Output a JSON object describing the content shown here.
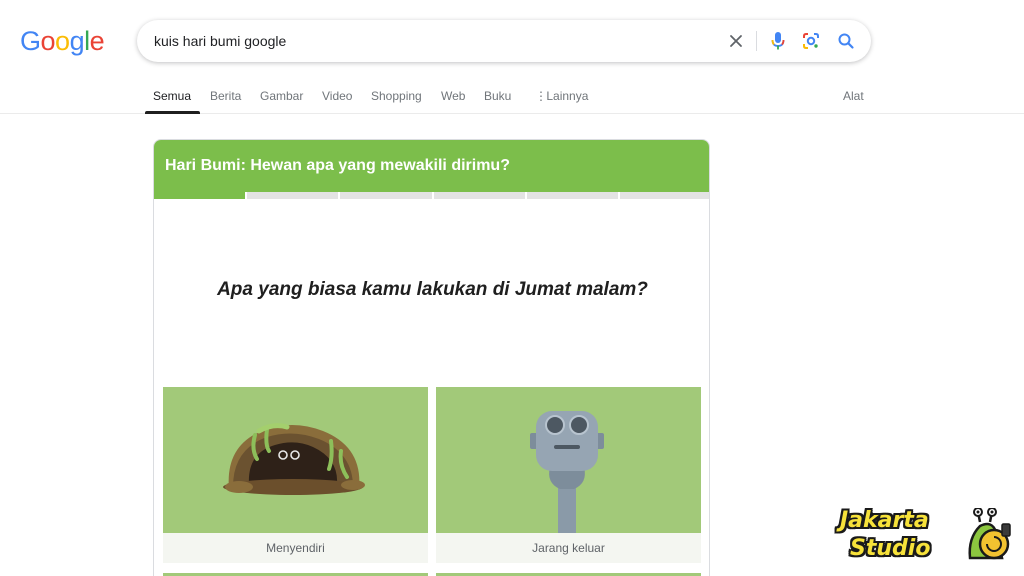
{
  "logo": {
    "letters": [
      "G",
      "o",
      "o",
      "g",
      "l",
      "e"
    ],
    "colors": [
      "#4285f4",
      "#ea4335",
      "#fbbc05",
      "#4285f4",
      "#34a853",
      "#ea4335"
    ]
  },
  "search": {
    "query": "kuis hari bumi google"
  },
  "tabs": [
    {
      "label": "Semua"
    },
    {
      "label": "Berita"
    },
    {
      "label": "Gambar"
    },
    {
      "label": "Video"
    },
    {
      "label": "Shopping"
    },
    {
      "label": "Web"
    },
    {
      "label": "Buku"
    },
    {
      "label": "Lainnya"
    }
  ],
  "tools_label": "Alat",
  "quiz": {
    "title": "Hari Bumi: Hewan apa yang mewakili dirimu?",
    "progress": {
      "completed": 1,
      "total": 6
    },
    "question": "Apa yang biasa kamu lakukan di Jumat malam?",
    "accent_color": "#7cbe4b",
    "options": [
      {
        "label": "Menyendiri",
        "icon": "burrow-with-eyes-icon"
      },
      {
        "label": "Jarang keluar",
        "icon": "binocular-viewer-icon"
      }
    ]
  },
  "watermark": {
    "line1": "Jakarta",
    "line2": "Studio",
    "icon": "snail-mascot-icon"
  }
}
